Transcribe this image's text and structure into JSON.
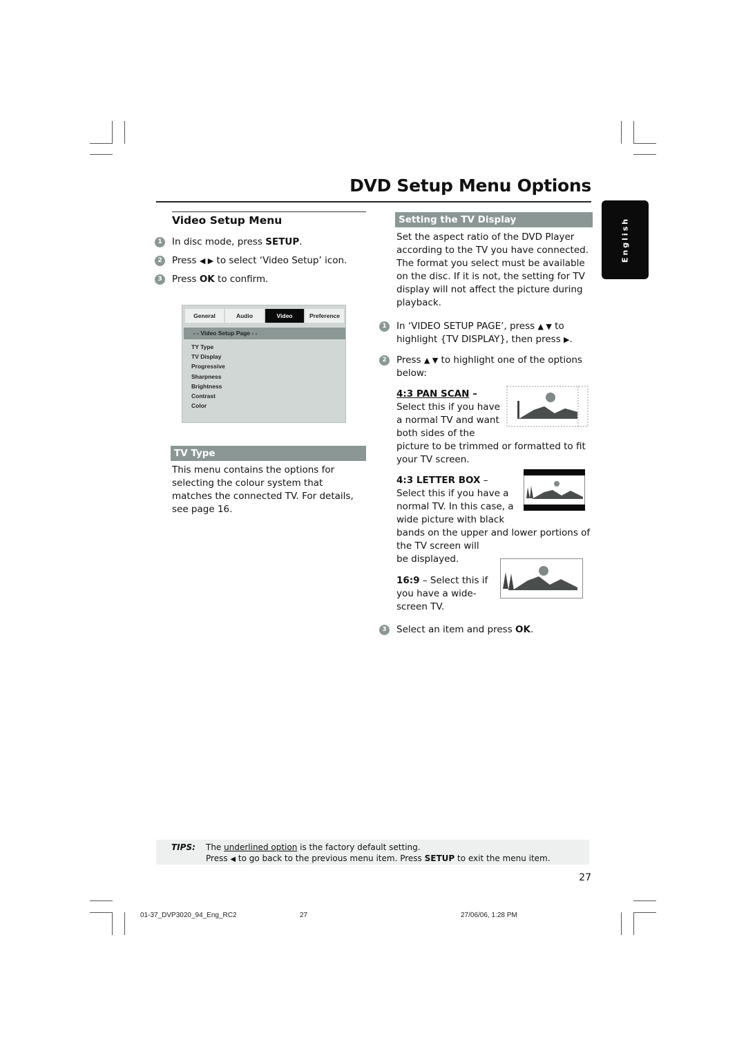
{
  "page": {
    "title": "DVD Setup Menu Options",
    "language_tab": "English",
    "page_number": "27"
  },
  "left": {
    "heading": "Video Setup Menu",
    "steps": [
      {
        "num": "1",
        "pre": "In disc mode, press ",
        "key": "SETUP",
        "post": "."
      },
      {
        "num": "2",
        "pre": "Press ",
        "arrows": "◀ ▶",
        "post": " to select ‘Video Setup’ icon."
      },
      {
        "num": "3",
        "pre": "Press ",
        "key": "OK",
        "post": " to confirm."
      }
    ],
    "menu": {
      "tabs": [
        "General",
        "Audio",
        "Video",
        "Preference"
      ],
      "active_tab": "Video",
      "band": "- -  Video Setup Page  - -",
      "items": [
        "TY Type",
        "TV Display",
        "Progressive",
        "Sharpness",
        "Brightness",
        "Contrast",
        "Color"
      ]
    },
    "tv_type": {
      "heading": "TV Type",
      "body": "This menu contains the options for selecting the colour system that matches the connected TV.  For details, see page 16."
    }
  },
  "right": {
    "heading": "Setting the TV Display",
    "intro": "Set the aspect ratio of the DVD Player according to the TV you have connected. The format you select must be available on the disc.  If it is not, the setting for TV display will not affect the picture during playback.",
    "step1": {
      "num": "1",
      "line1_pre": "In ‘VIDEO SETUP PAGE’, press ",
      "arrows": "▲ ▼",
      "line1_post": " to",
      "line2": "highlight {TV DISPLAY}, then press ",
      "arrow_right": "▶",
      "line2_end": "."
    },
    "step2": {
      "num": "2",
      "pre": "Press ",
      "arrows": "▲ ▼",
      "post": " to highlight one of the options",
      "line2": "below:"
    },
    "options": [
      {
        "label": "4:3 PAN SCAN",
        "dash": " –",
        "lines": [
          "Select this if you have",
          "a normal TV and want",
          "both sides of the",
          "picture to be trimmed or formatted to fit",
          "your TV screen."
        ]
      },
      {
        "label": "4:3 LETTER BOX",
        "dash": " –",
        "lines": [
          "Select this if you have a",
          "normal TV. In this case, a",
          "wide picture with black",
          "bands on the upper and lower portions of",
          "the TV screen will",
          "be displayed."
        ]
      },
      {
        "label": "16:9",
        "dash": " – Select this if",
        "lines": [
          "you have a wide-",
          "screen TV."
        ]
      }
    ],
    "step3": {
      "num": "3",
      "pre": "Select an item and press ",
      "key": "OK",
      "post": "."
    }
  },
  "tips": {
    "label": "TIPS:",
    "line1_pre": "The ",
    "line1_underlined": "underlined option",
    "line1_post": " is the factory default setting.",
    "line2_pre": "Press ",
    "line2_arrow": "◀",
    "line2_mid": " to go back to the previous menu item. Press ",
    "line2_key": "SETUP",
    "line2_post": " to exit the menu item."
  },
  "footer": {
    "file": "01-37_DVP3020_94_Eng_RC2",
    "page": "27",
    "date": "27/06/06, 1:28 PM"
  }
}
